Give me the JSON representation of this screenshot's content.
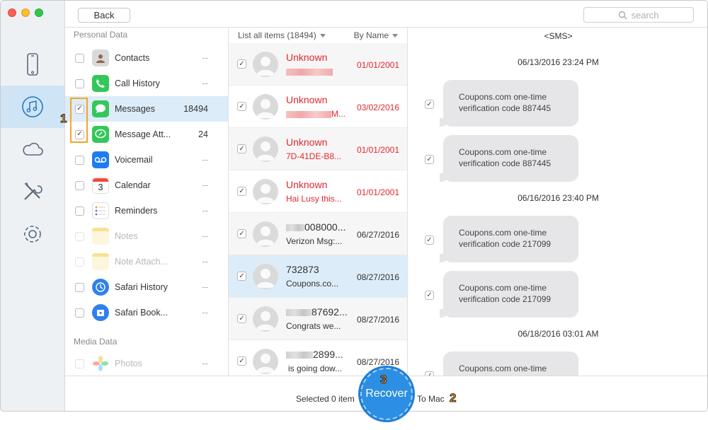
{
  "toolbar": {
    "back_label": "Back",
    "search_placeholder": "search"
  },
  "categories": {
    "personal_title": "Personal Data",
    "media_title": "Media Data",
    "items": [
      {
        "label": "Contacts",
        "count": "--",
        "checked": false,
        "disabled": false,
        "icon": "contacts-icon"
      },
      {
        "label": "Call History",
        "count": "--",
        "checked": false,
        "disabled": false,
        "icon": "phone-icon"
      },
      {
        "label": "Messages",
        "count": "18494",
        "checked": true,
        "disabled": false,
        "icon": "messages-icon"
      },
      {
        "label": "Message Att...",
        "count": "24",
        "checked": true,
        "disabled": false,
        "icon": "message-attachment-icon"
      },
      {
        "label": "Voicemail",
        "count": "--",
        "checked": false,
        "disabled": false,
        "icon": "voicemail-icon"
      },
      {
        "label": "Calendar",
        "count": "--",
        "checked": false,
        "disabled": false,
        "icon": "calendar-icon"
      },
      {
        "label": "Reminders",
        "count": "--",
        "checked": false,
        "disabled": false,
        "icon": "reminders-icon"
      },
      {
        "label": "Notes",
        "count": "--",
        "checked": false,
        "disabled": true,
        "icon": "notes-icon"
      },
      {
        "label": "Note Attach...",
        "count": "--",
        "checked": false,
        "disabled": true,
        "icon": "note-attachment-icon"
      },
      {
        "label": "Safari History",
        "count": "--",
        "checked": false,
        "disabled": false,
        "icon": "safari-history-icon"
      },
      {
        "label": "Safari Book...",
        "count": "--",
        "checked": false,
        "disabled": false,
        "icon": "safari-bookmark-icon"
      },
      {
        "label": "Photos",
        "count": "--",
        "checked": false,
        "disabled": true,
        "icon": "photos-icon"
      }
    ],
    "calendar_day": "3"
  },
  "list": {
    "header_all": "List all items (18494)",
    "header_sort": "By Name",
    "rows": [
      {
        "name": "Unknown",
        "sub": "",
        "date": "01/01/2001",
        "red": true
      },
      {
        "name": "Unknown",
        "sub": "M...",
        "date": "03/02/2016",
        "red": true
      },
      {
        "name": "Unknown",
        "sub": "7D-41DE-B8...",
        "date": "01/01/2001",
        "red": true
      },
      {
        "name": "Unknown",
        "sub": "Hai Lusy this...",
        "date": "01/01/2001",
        "red": true
      },
      {
        "name": "008000...",
        "sub": "Verizon Msg:...",
        "date": "06/27/2016",
        "red": false
      },
      {
        "name": "732873",
        "sub": "Coupons.co...",
        "date": "08/27/2016",
        "red": false
      },
      {
        "name": "87692...",
        "sub": "Congrats we...",
        "date": "08/27/2016",
        "red": false
      },
      {
        "name": "2899...",
        "sub": "is going dow...",
        "date": "08/27/2016",
        "red": false
      }
    ]
  },
  "detail": {
    "tag": "<SMS>",
    "stamps": [
      "06/13/2016 23:24 PM",
      "06/16/2016 23:40 PM",
      "06/18/2016 03:01 AM"
    ],
    "bubbles": [
      {
        "line1": "Coupons.com one-time",
        "line2": "verification code 887445"
      },
      {
        "line1": "Coupons.com one-time",
        "line2": "verification code 887445"
      },
      {
        "line1": "Coupons.com one-time",
        "line2": "verification code 217099"
      },
      {
        "line1": "Coupons.com one-time",
        "line2": "verification code 217099"
      },
      {
        "line1": "Coupons.com one-time",
        "line2": ""
      }
    ]
  },
  "bottom": {
    "selected": "Selected 0 item",
    "recover": "Recover",
    "to_mac": "To Mac"
  },
  "callouts": {
    "step1": "1",
    "step2": "2",
    "step3": "3"
  },
  "colors": {
    "accent": "#2d8fe3",
    "selection": "#dcecf8",
    "deleted_red": "#e5262e",
    "callout_orange": "#f5a623"
  }
}
